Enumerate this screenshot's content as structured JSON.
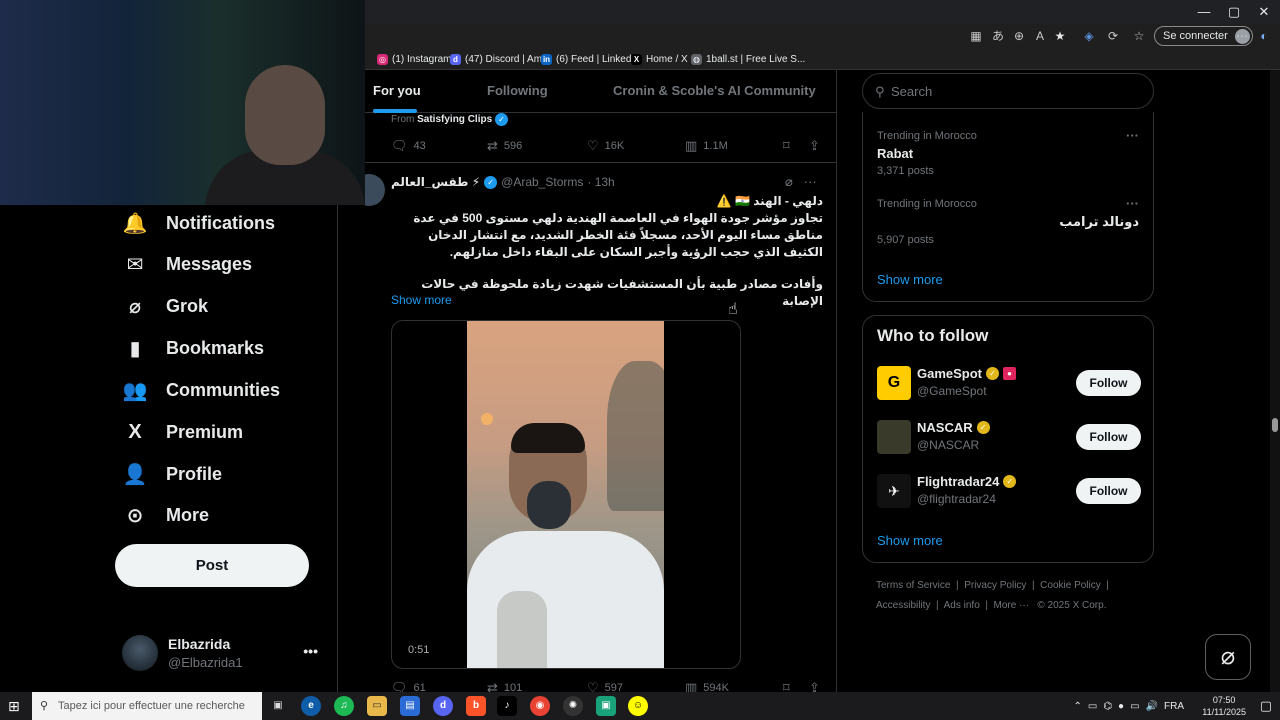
{
  "browser": {
    "connect_label": "Se connecter",
    "window_controls": [
      "—",
      "▢",
      "✕"
    ],
    "favorites": [
      {
        "label": "(1) Instagram",
        "icon": "instagram-icon",
        "color": "#d62976"
      },
      {
        "label": "(47) Discord | Amis",
        "icon": "discord-icon",
        "color": "#5865f2"
      },
      {
        "label": "(6) Feed | LinkedIn",
        "icon": "linkedin-icon",
        "color": "#0a66c2"
      },
      {
        "label": "Home / X",
        "icon": "x-icon",
        "color": "#000000"
      },
      {
        "label": "1ball.st | Free Live S...",
        "icon": "globe-icon",
        "color": "#5f6368"
      }
    ]
  },
  "nav": {
    "items": [
      {
        "label": "Notifications",
        "icon": "bell-icon",
        "glyph": "🔔"
      },
      {
        "label": "Messages",
        "icon": "envelope-icon",
        "glyph": "✉"
      },
      {
        "label": "Grok",
        "icon": "grok-icon",
        "glyph": "⌀"
      },
      {
        "label": "Bookmarks",
        "icon": "bookmark-icon",
        "glyph": "🔖"
      },
      {
        "label": "Communities",
        "icon": "communities-icon",
        "glyph": "👥"
      },
      {
        "label": "Premium",
        "icon": "x-logo-icon",
        "glyph": "𝕏"
      },
      {
        "label": "Profile",
        "icon": "person-icon",
        "glyph": "👤"
      },
      {
        "label": "More",
        "icon": "more-circle-icon",
        "glyph": "⋯"
      }
    ],
    "post_label": "Post",
    "account": {
      "name": "Elbazrida",
      "handle": "@Elbazrida1",
      "more": "•••"
    }
  },
  "timeline": {
    "tabs": [
      "For you",
      "Following",
      "Cronin & Scoble's AI Community"
    ],
    "prev_from": "From",
    "prev_from_name": "Satisfying Clips",
    "prev_actions": {
      "replies": "43",
      "reposts": "596",
      "likes": "16K",
      "views": "1.1M"
    },
    "tweet": {
      "name": "طقس_العالم ⚡",
      "handle": "@Arab_Storms",
      "time": "· 13h",
      "lines": [
        "دلهي - الهند 🇮🇳 ⚠️",
        "تجاوز مؤشر جودة الهواء في العاصمة الهندية دلهي مستوى 500 في عدة مناطق مساء اليوم الأحد، مسجلاً فئة الخطر الشديد، مع انتشار الدخان الكثيف الذي حجب الرؤية وأجبر السكان على البقاء داخل منازلهم.",
        "وأفادت مصادر طبية بأن المستشفيات شهدت زيادة ملحوظة في حالات الإصابة"
      ],
      "show_more": "Show more",
      "video_time": "0:51",
      "actions": {
        "replies": "61",
        "reposts": "101",
        "likes": "597",
        "views": "594K"
      }
    }
  },
  "sidebar": {
    "search_placeholder": "Search",
    "trends": [
      {
        "context": "Trending in Morocco",
        "title": "Rabat",
        "count": "3,371 posts"
      },
      {
        "context": "Trending in Morocco",
        "title": "دونالد ترامب",
        "count": "5,907 posts"
      }
    ],
    "trends_show_more": "Show more",
    "who_to_follow_title": "Who to follow",
    "follow": [
      {
        "name": "GameSpot",
        "handle": "@GameSpot",
        "color": "#ffcc00",
        "button": "Follow"
      },
      {
        "name": "NASCAR",
        "handle": "@NASCAR",
        "color": "#3a3a2a",
        "button": "Follow"
      },
      {
        "name": "Flightradar24",
        "handle": "@flightradar24",
        "color": "#111111",
        "button": "Follow"
      }
    ],
    "follow_show_more": "Show more",
    "footer": [
      "Terms of Service",
      "Privacy Policy",
      "Cookie Policy",
      "Accessibility",
      "Ads info",
      "More ···",
      "© 2025 X Corp."
    ]
  },
  "taskbar": {
    "search_placeholder": "Tapez ici pour effectuer une recherche",
    "lang": "FRA",
    "time": "07:50",
    "date": "11/11/2025"
  }
}
